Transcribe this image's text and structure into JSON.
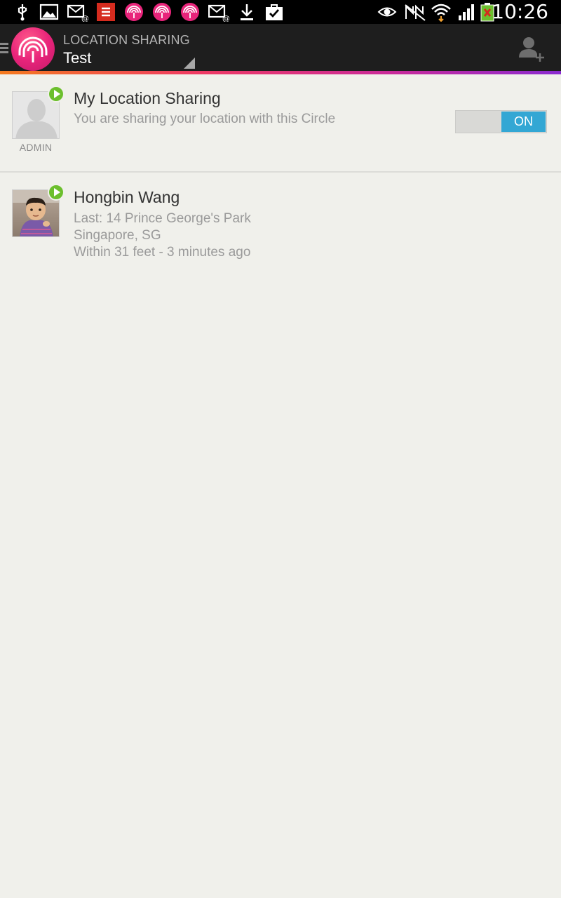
{
  "status_bar": {
    "time": "10:26",
    "left_icons": [
      "usb-icon",
      "gallery-icon",
      "email-icon",
      "flipboard-icon",
      "life360-icon",
      "life360-icon",
      "life360-icon",
      "email-icon",
      "download-icon",
      "bag-check-icon"
    ],
    "right_icons": [
      "eye-icon",
      "no-signal-icon",
      "wifi-icon",
      "cell-signal-icon",
      "battery-icon"
    ]
  },
  "action_bar": {
    "subtitle": "LOCATION SHARING",
    "title": "Test",
    "colors": {
      "background": "#1e1e1e",
      "accent_gradient": [
        "#f47a1e",
        "#ef3b63",
        "#c92a9a",
        "#8a2bd0"
      ],
      "logo": "#e8247a"
    }
  },
  "my_sharing": {
    "title": "My Location Sharing",
    "description": "You are sharing your location with this Circle",
    "role_label": "ADMIN",
    "toggle_label": "ON",
    "toggle_on": true,
    "toggle_color": "#33a7d4"
  },
  "members": [
    {
      "name": "Hongbin Wang",
      "last_location": "Last: 14 Prince George's Park",
      "city": "Singapore, SG",
      "accuracy": "Within 31 feet - 3 minutes ago",
      "status_color": "#6cbf2d"
    }
  ]
}
